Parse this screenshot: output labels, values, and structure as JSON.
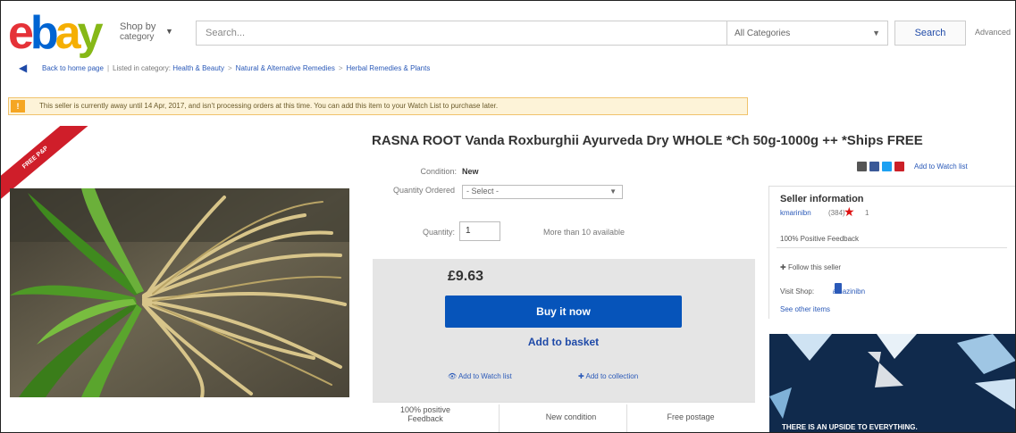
{
  "header": {
    "logo_letters": [
      "e",
      "b",
      "a",
      "y"
    ],
    "logo_colors": [
      "#e53238",
      "#0064d2",
      "#f5af02",
      "#86b817"
    ],
    "shop_by": "Shop by",
    "shop_by_category": "category",
    "search_placeholder": "Search...",
    "category_select": "All Categories",
    "search_button": "Search",
    "advanced": "Advanced"
  },
  "breadcrumb": {
    "back": "Back to home page",
    "listed_in": "Listed in category:",
    "items": [
      "Health & Beauty",
      "Natural & Alternative Remedies",
      "Herbal Remedies & Plants"
    ]
  },
  "notice": {
    "text": "This seller is currently away until 14 Apr, 2017, and isn't processing orders at this time. You can add this item to your Watch List to purchase later."
  },
  "listing": {
    "ribbon": "FREE P&P",
    "title": "RASNA ROOT Vanda Roxburghii Ayurveda Dry WHOLE *Ch 50g-1000g ++ *Ships FREE",
    "condition_label": "Condition:",
    "condition_value": "New",
    "quantity_ordered_label": "Quantity Ordered",
    "quantity_select": "- Select -",
    "quantity_label": "Quantity:",
    "quantity_value": "1",
    "availability": "More than 10 available",
    "price": "£9.63",
    "buy_now": "Buy it now",
    "add_to_basket": "Add to basket",
    "add_to_watch_list": "Add to Watch list",
    "add_to_collection": "Add to collection",
    "features": [
      "100% positive Feedback",
      "New condition",
      "Free postage"
    ]
  },
  "seller": {
    "add_to_watch": "Add to Watch list",
    "title": "Seller information",
    "name": "kmarinibn",
    "score": "(384)",
    "star_count": "1",
    "positive_feedback": "100% Positive Feedback",
    "follow": "Follow this seller",
    "visit_shop": "Visit Shop:",
    "shop_name": "amazinibn",
    "see_other_items": "See other items"
  },
  "ad": {
    "text": "THERE IS AN UPSIDE TO EVERYTHING."
  }
}
